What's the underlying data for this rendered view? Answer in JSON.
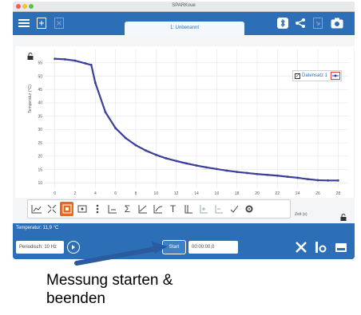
{
  "window": {
    "title": "SPARKvue"
  },
  "toolbar": {
    "file_tab": "1: Unbenannt"
  },
  "graph": {
    "y_label": "Temperatur (°C)",
    "x_label": "Zeit (s)",
    "legend_label": "Datensatz 1"
  },
  "chart_data": {
    "type": "line",
    "x": [
      0,
      1,
      2,
      3,
      3.6,
      4,
      5,
      6,
      7,
      8,
      9,
      10,
      11,
      12,
      13,
      14,
      15,
      16,
      17,
      18,
      19,
      20,
      21,
      22,
      23,
      24,
      25,
      26,
      27,
      28
    ],
    "y": [
      56.5,
      56.3,
      55.8,
      54.8,
      54.2,
      47.5,
      36.5,
      30.5,
      26.8,
      24.1,
      22.1,
      20.5,
      19.2,
      18.2,
      17.3,
      16.5,
      15.8,
      15.2,
      14.6,
      14.1,
      13.7,
      13.3,
      13.0,
      12.7,
      12.3,
      11.9,
      11.4,
      11.0,
      10.9,
      10.9
    ],
    "xlim": [
      -1,
      29
    ],
    "ylim": [
      8,
      60
    ],
    "x_ticks": [
      0,
      2,
      4,
      6,
      8,
      10,
      12,
      14,
      16,
      18,
      20,
      22,
      24,
      26,
      28
    ],
    "y_ticks": [
      10,
      15,
      20,
      25,
      30,
      35,
      40,
      45,
      50,
      55
    ],
    "ylabel": "Temperatur (°C)",
    "xlabel": "Zeit (s)",
    "grid": true,
    "series_color": "#3a3f9a"
  },
  "status": {
    "sensor_reading": "Temperatur: 11,9 °C"
  },
  "controls": {
    "rate": "Periodisch: 10 Hz",
    "start_label": "Start",
    "timer": "00:00:00,0"
  },
  "annotation": {
    "caption_line1": "Messung starten &",
    "caption_line2": "beenden"
  },
  "colors": {
    "accent": "#2d6fb7",
    "active_tool": "#e86a1c",
    "arrow": "#2a5a9f"
  }
}
